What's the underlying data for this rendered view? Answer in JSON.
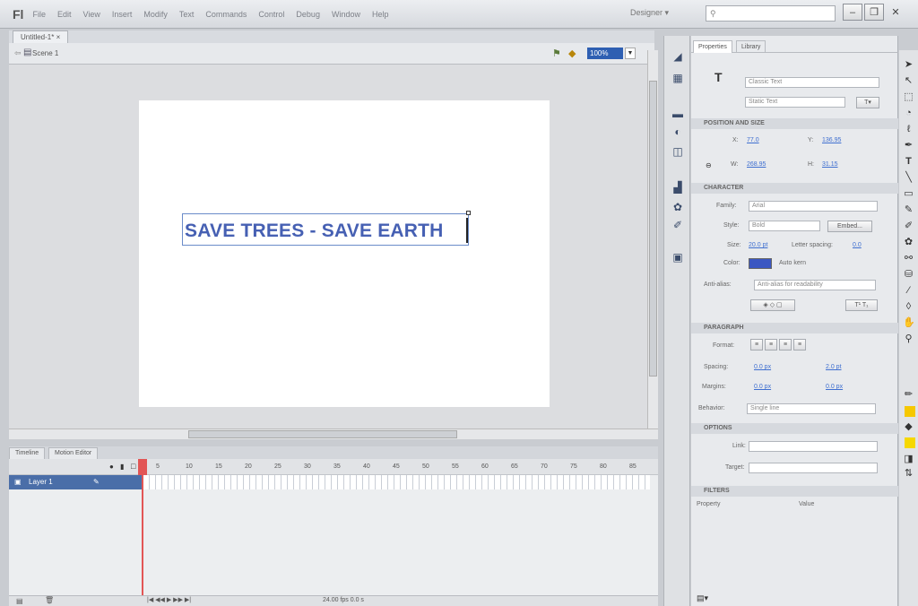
{
  "app": {
    "logo": "Fl",
    "workspace": "Designer ▾"
  },
  "menu": [
    "File",
    "Edit",
    "View",
    "Insert",
    "Modify",
    "Text",
    "Commands",
    "Control",
    "Debug",
    "Window",
    "Help"
  ],
  "search": {
    "placeholder": ""
  },
  "window_controls": {
    "minimize": "–",
    "restore": "❐",
    "close": "✕"
  },
  "document": {
    "tab": "Untitled-1* ×",
    "scene": "Scene 1",
    "zoom": "100%"
  },
  "stage": {
    "text": "SAVE TREES - SAVE EARTH"
  },
  "timeline": {
    "tabs": [
      "Timeline",
      "Motion Editor"
    ],
    "frame_numbers": [
      "5",
      "10",
      "15",
      "20",
      "25",
      "30",
      "35",
      "40",
      "45",
      "50",
      "55",
      "60",
      "65",
      "70",
      "75",
      "80",
      "85"
    ],
    "layer": "Layer 1",
    "footer": "24.00 fps  0.0 s"
  },
  "properties": {
    "tabs": [
      "Properties",
      "Library"
    ],
    "text_engine": "Classic Text",
    "text_type": "Static Text",
    "sections": {
      "position": "POSITION AND SIZE",
      "character": "CHARACTER",
      "paragraph": "PARAGRAPH",
      "options": "OPTIONS",
      "filters": "FILTERS"
    },
    "x_label": "X:",
    "x_value": "77.0",
    "y_label": "Y:",
    "y_value": "136.95",
    "w_label": "W:",
    "w_value": "268.95",
    "h_label": "H:",
    "h_value": "31.15",
    "family_label": "Family:",
    "family_value": "Arial",
    "style_label": "Style:",
    "style_value": "Bold",
    "embed_label": "Embed...",
    "size_label": "Size:",
    "size_value": "20.0 pt",
    "letter_spacing_label": "Letter spacing:",
    "letter_spacing_value": "0.0",
    "color_label": "Color:",
    "auto_kern_label": "Auto kern",
    "antialias_label": "Anti-alias:",
    "antialias_value": "Anti-alias for readability",
    "format_label": "Format:",
    "spacing_label": "Spacing:",
    "spacing_value": "0.0 px",
    "spacing_value2": "2.0 pt",
    "margins_label": "Margins:",
    "margins_value": "0.0 px",
    "margins_value2": "0.0 px",
    "behavior_label": "Behavior:",
    "behavior_value": "Single line",
    "link_label": "Link:",
    "target_label": "Target:",
    "filters_property": "Property",
    "filters_value": "Value"
  }
}
